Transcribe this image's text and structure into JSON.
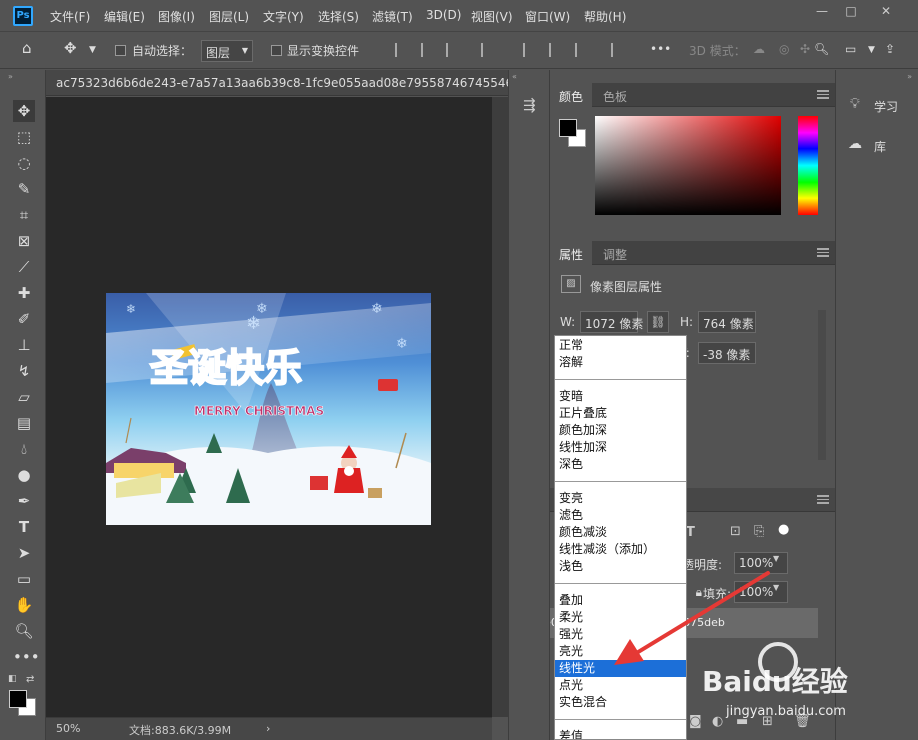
{
  "app": {
    "logo": "Ps"
  },
  "menubar": {
    "items": [
      "文件(F)",
      "编辑(E)",
      "图像(I)",
      "图层(L)",
      "文字(Y)",
      "选择(S)",
      "滤镜(T)",
      "3D(D)",
      "视图(V)",
      "窗口(W)",
      "帮助(H)"
    ],
    "window_buttons": [
      "—",
      "□",
      "✕"
    ]
  },
  "options_bar": {
    "auto_select_label": "自动选择：",
    "auto_select_target": "图层",
    "show_transform_label": "显示变换控件",
    "mode_3d_label": "3D 模式：",
    "more": "•••"
  },
  "document": {
    "tab_title": "ac75323d6b6de243-e7a57a13aa6b39c8-1fc9e055aad08e79558746745546",
    "zoom": "50%",
    "doc_info": "文档:883.6K/3.99M"
  },
  "image_content": {
    "title": "圣诞快乐",
    "subtitle": "MERRY CHRISTMAS"
  },
  "color_panel": {
    "tabs": [
      "颜色",
      "色板"
    ],
    "foreground": "#000000",
    "background": "#ffffff"
  },
  "properties_panel": {
    "tabs": [
      "属性",
      "调整"
    ],
    "section_title": "像素图层属性",
    "w_label": "W:",
    "w_value": "1072 像素",
    "h_label": "H:",
    "h_value": "764 像素",
    "y_label": "Y:",
    "y_value": "-38 像素"
  },
  "layers_panel": {
    "opacity_label": "不透明度:",
    "opacity_value": "100%",
    "fill_label": "填充:",
    "fill_value": "100%",
    "layer_name": "ac75323d6b6de243-e7a57a13aa6b39c8-1fc9e055aad08e79...f7626de375deb"
  },
  "far_dock": {
    "learn_label": "学习",
    "library_label": "库"
  },
  "blend_modes": {
    "groups": [
      [
        "正常",
        "溶解"
      ],
      [
        "变暗",
        "正片叠底",
        "颜色加深",
        "线性加深",
        "深色"
      ],
      [
        "变亮",
        "滤色",
        "颜色减淡",
        "线性减淡（添加）",
        "浅色"
      ],
      [
        "叠加",
        "柔光",
        "强光",
        "亮光",
        "线性光",
        "点光",
        "实色混合"
      ],
      [
        "差值"
      ]
    ],
    "selected": "线性光",
    "highlight_color": "#1c6fd8"
  },
  "watermark": {
    "brand": "Baidu经验",
    "url": "jingyan.baidu.com"
  },
  "annotation": {
    "arrow_color": "#e53935"
  }
}
